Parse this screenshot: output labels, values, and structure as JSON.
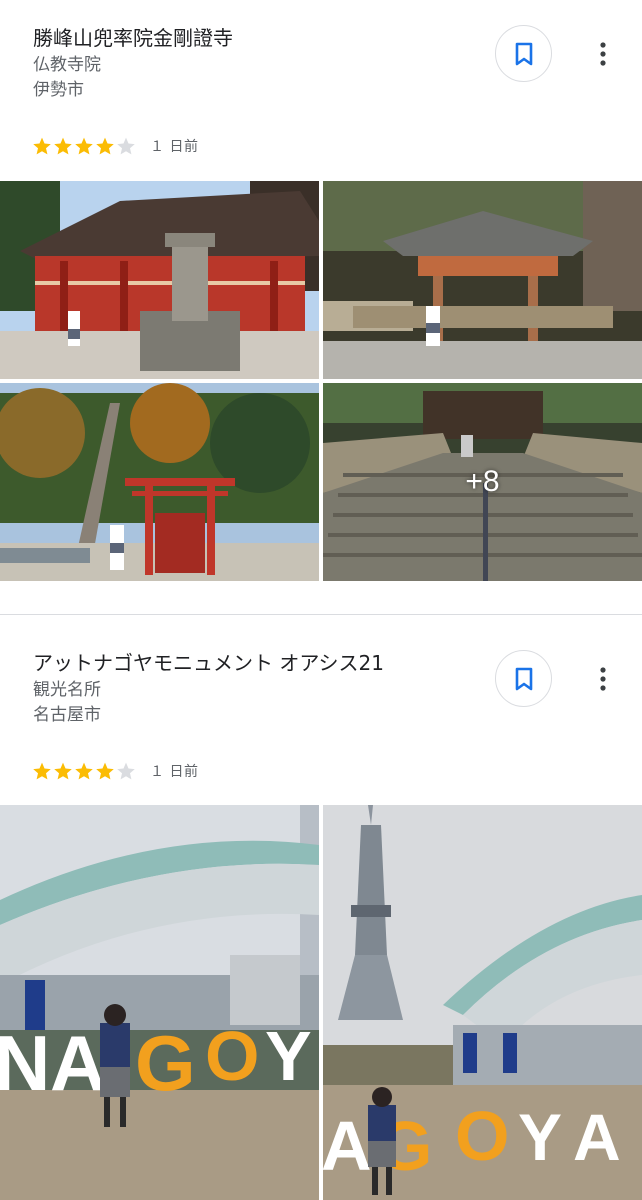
{
  "places": [
    {
      "title": "勝峰山兜率院金剛證寺",
      "category": "仏教寺院",
      "city": "伊勢市",
      "rating": 4,
      "max_rating": 5,
      "time_ago": "１ 日前",
      "more_photos": "+8"
    },
    {
      "title": "アットナゴヤモニュメント オアシス21",
      "category": "観光名所",
      "city": "名古屋市",
      "rating": 4,
      "max_rating": 5,
      "time_ago": "１ 日前"
    }
  ],
  "colors": {
    "star_filled": "#fbbc04",
    "star_empty": "#dadce0",
    "accent": "#1a73e8",
    "text_primary": "#202124",
    "text_secondary": "#5f6368"
  },
  "icons": {
    "bookmark": "bookmark-icon",
    "more": "more-vert-icon",
    "star": "star-icon"
  }
}
